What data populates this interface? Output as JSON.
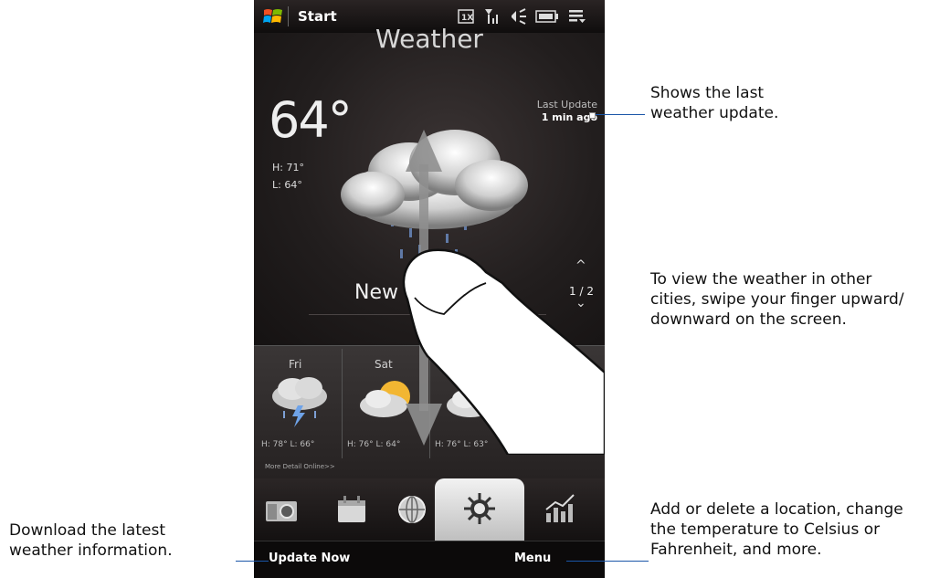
{
  "statusbar": {
    "start_label": "Start",
    "icons": [
      "windows-logo-icon",
      "1x-network-icon",
      "signal-icon",
      "speaker-icon",
      "battery-icon",
      "menu-icon"
    ]
  },
  "weather": {
    "title": "Weather",
    "temperature": "64°",
    "high": "H: 71°",
    "low": "L: 64°",
    "last_update_label": "Last Update",
    "last_update_value": "1 min ago",
    "city_partial": "New",
    "page_indicator": "1 / 2",
    "condition_icon": "rain-cloud-icon"
  },
  "forecast": {
    "days": [
      {
        "label": "Fri",
        "hilo": "H: 78°  L: 66°",
        "icon": "thunderstorm-icon"
      },
      {
        "label": "Sat",
        "hilo": "H: 76°  L: 64°",
        "icon": "partly-cloudy-icon"
      },
      {
        "label": "",
        "hilo": "H: 76°  L: 63°",
        "icon": "partly-cloudy-icon"
      }
    ],
    "more_detail": "More Detail Online>>"
  },
  "tabs": [
    "photos-tab-icon",
    "calendar-tab-icon",
    "internet-tab-icon",
    "weather-tab-icon",
    "stocks-tab-icon"
  ],
  "softkeys": {
    "left": "Update Now",
    "right": "Menu"
  },
  "annotations": {
    "last_update": [
      "Shows the last",
      "weather update."
    ],
    "swipe": [
      "To view the weather in other",
      "cities, swipe your finger upward/",
      "downward on the screen."
    ],
    "menu": [
      "Add or delete a location, change",
      "the temperature to Celsius or",
      "Fahrenheit, and more."
    ],
    "update": [
      "Download the latest",
      "weather information."
    ]
  },
  "colors": {
    "callout_line": "#1a56a8",
    "screen_bg": "#1f1c1c"
  }
}
